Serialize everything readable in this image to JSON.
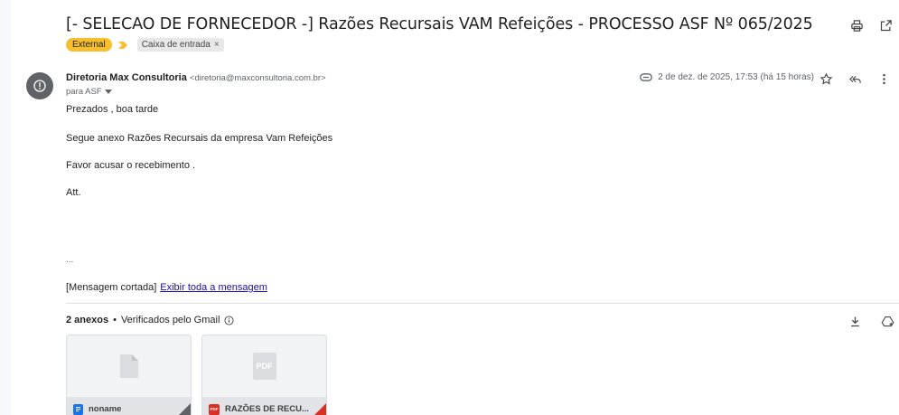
{
  "subject": "[- SELECAO DE FORNECEDOR -] Razões Recursais VAM Refeições - PROCESSO ASF Nº 065/2025",
  "labels": {
    "external": "External",
    "inbox": "Caixa de entrada",
    "inbox_remove": "×"
  },
  "sender": {
    "name": "Diretoria Max Consultoria",
    "email": "<diretoria@maxconsultoria.com.br>",
    "recipient": "para ASF"
  },
  "meta": {
    "date": "2 de dez. de 2025, 17:53 (há 15 horas)"
  },
  "body": {
    "lines": [
      "Prezados , boa tarde",
      "Segue anexo Razões Recursais da empresa Vam Refeições",
      "Favor acusar o recebimento .",
      "Att."
    ],
    "ellipsis": "...",
    "trimmed_label": "[Mensagem cortada]",
    "view_full_link": "Exibir toda a mensagem"
  },
  "attachments": {
    "count_label": "2 anexos",
    "separator": "•",
    "verified_label": "Verificados pelo Gmail",
    "items": [
      {
        "name": "noname",
        "type": "doc-file-icon",
        "color": "#1a73e8"
      },
      {
        "name": "RAZÕES DE RECU...",
        "type": "pdf-file-icon",
        "color": "#d93025",
        "preview_text": "PDF",
        "type_badge": "PDF"
      }
    ]
  },
  "colors": {
    "external_label": "#f8bf2c",
    "importance_marker": "#f8bf2c",
    "link": "#1a0dab",
    "avatar": "#5f6368"
  }
}
